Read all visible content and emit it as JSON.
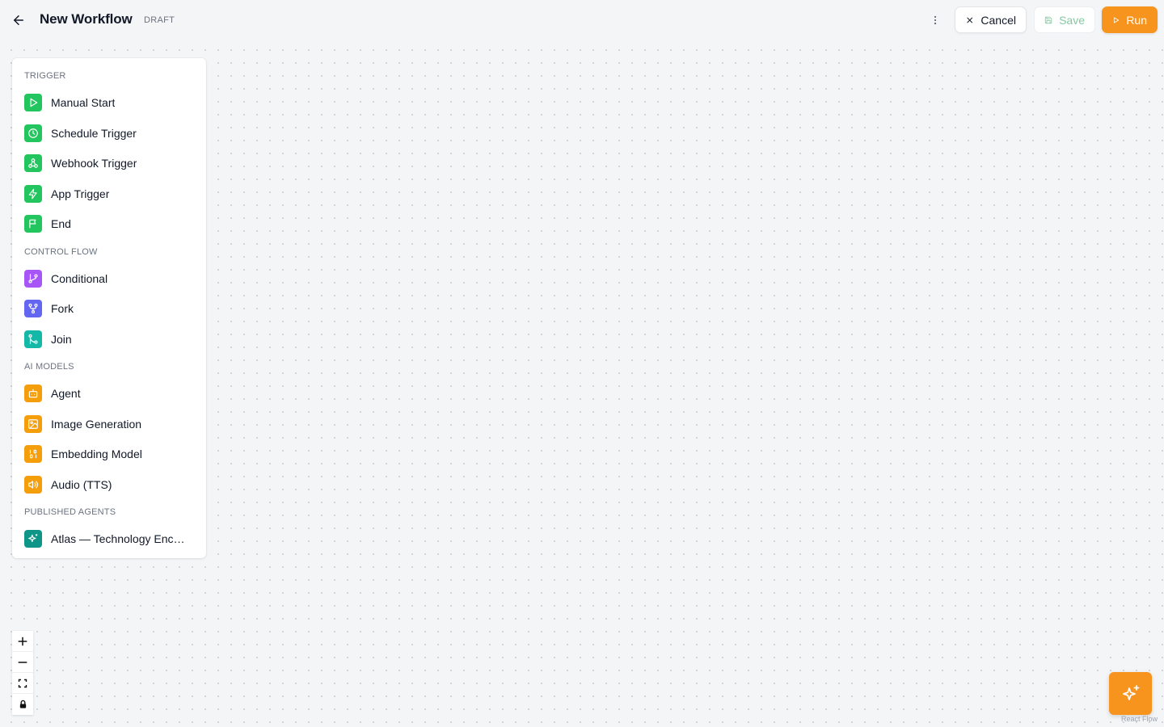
{
  "header": {
    "title": "New Workflow",
    "status_badge": "DRAFT",
    "cancel_label": "Cancel",
    "save_label": "Save",
    "run_label": "Run",
    "icons": {
      "back": "arrow-left-icon",
      "more": "more-vertical-icon",
      "cancel": "x-icon",
      "save": "save-icon",
      "run": "play-icon"
    }
  },
  "palette": {
    "sections": [
      {
        "label": "TRIGGER",
        "items": [
          {
            "label": "Manual Start",
            "icon": "play-icon",
            "color": "#22c55e"
          },
          {
            "label": "Schedule Trigger",
            "icon": "clock-icon",
            "color": "#22c55e"
          },
          {
            "label": "Webhook Trigger",
            "icon": "webhook-icon",
            "color": "#22c55e"
          },
          {
            "label": "App Trigger",
            "icon": "zap-icon",
            "color": "#22c55e"
          },
          {
            "label": "End",
            "icon": "flag-icon",
            "color": "#22c55e"
          }
        ]
      },
      {
        "label": "CONTROL FLOW",
        "items": [
          {
            "label": "Conditional",
            "icon": "git-branch-icon",
            "color": "#a855f7"
          },
          {
            "label": "Fork",
            "icon": "git-fork-icon",
            "color": "#6366f1"
          },
          {
            "label": "Join",
            "icon": "git-merge-icon",
            "color": "#14b8a6"
          }
        ]
      },
      {
        "label": "AI MODELS",
        "items": [
          {
            "label": "Agent",
            "icon": "bot-icon",
            "color": "#f59e0b"
          },
          {
            "label": "Image Generation",
            "icon": "image-icon",
            "color": "#f59e0b"
          },
          {
            "label": "Embedding Model",
            "icon": "binary-icon",
            "color": "#f59e0b"
          },
          {
            "label": "Audio (TTS)",
            "icon": "volume-icon",
            "color": "#f59e0b"
          }
        ]
      },
      {
        "label": "PUBLISHED AGENTS",
        "items": [
          {
            "label": "Atlas — Technology Encyclopedia",
            "icon": "sparkles-icon",
            "color": "#0f9488"
          }
        ]
      }
    ]
  },
  "canvas_controls": {
    "zoom_in": "plus-icon",
    "zoom_out": "minus-icon",
    "fit_view": "maximize-icon",
    "lock": "lock-icon"
  },
  "ai_assistant": {
    "icon": "sparkles-icon",
    "color": "#f7941d"
  },
  "attribution": "React Flow"
}
